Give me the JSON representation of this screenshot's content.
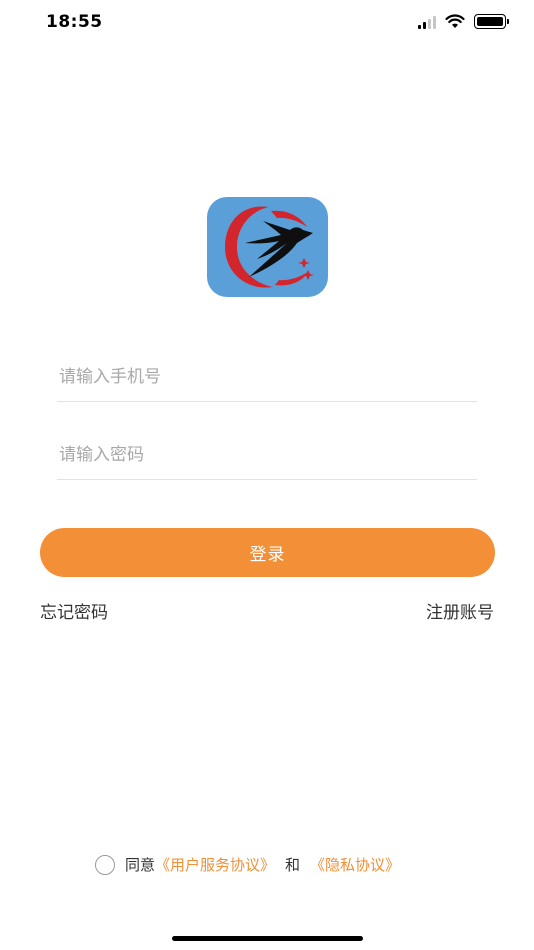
{
  "status_bar": {
    "time": "18:55",
    "signal_icon": "cellular-signal-icon",
    "wifi_icon": "wifi-icon",
    "battery_icon": "battery-icon"
  },
  "logo": {
    "icon": "swallow-logo-icon",
    "background_color": "#5b9fd9"
  },
  "form": {
    "phone_placeholder": "请输入手机号",
    "phone_value": "",
    "password_placeholder": "请输入密码",
    "password_value": "",
    "login_label": "登录"
  },
  "links": {
    "forgot_password": "忘记密码",
    "register": "注册账号"
  },
  "agreement": {
    "agree_text": "同意",
    "user_agreement": "《用户服务协议》",
    "and_text": "和",
    "privacy_policy": "《隐私协议》",
    "checked": false
  },
  "colors": {
    "accent": "#f28f37",
    "input_border": "#e3e3e3",
    "placeholder": "#a8a8a8"
  }
}
